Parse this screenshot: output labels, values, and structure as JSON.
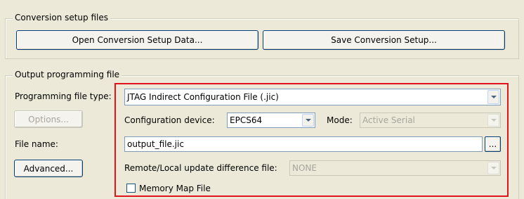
{
  "conversion_group": {
    "legend": "Conversion setup files",
    "open_button_label": "Open Conversion Setup Data...",
    "save_button_label": "Save Conversion Setup..."
  },
  "output_group": {
    "legend": "Output programming file",
    "programming_file_type_label": "Programming file type:",
    "programming_file_type_value": "JTAG Indirect Configuration File (.jic)",
    "options_button_label": "Options...",
    "configuration_device_label": "Configuration device:",
    "configuration_device_value": "EPCS64",
    "mode_label": "Mode:",
    "mode_value": "Active Serial",
    "file_name_label": "File name:",
    "file_name_value": "output_file.jic",
    "browse_button_label": "...",
    "advanced_button_label": "Advanced...",
    "remote_local_label": "Remote/Local update difference file:",
    "remote_local_value": "NONE",
    "memory_map_label": "Memory Map File",
    "memory_map_checked": false
  },
  "highlight_color": "#e3131b"
}
